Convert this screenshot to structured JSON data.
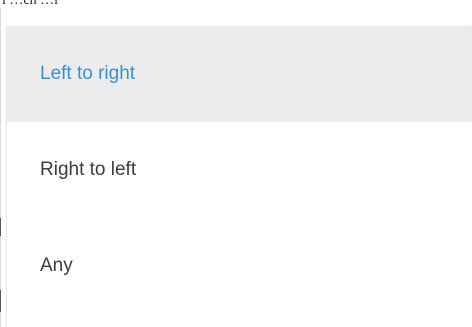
{
  "background": {
    "partial_text": "l …ch …l"
  },
  "menu": {
    "items": [
      {
        "label": "Left to right",
        "selected": true
      },
      {
        "label": "Right to left",
        "selected": false
      },
      {
        "label": "Any",
        "selected": false
      }
    ]
  },
  "colors": {
    "selected_text": "#3b8fd9",
    "selected_background": "#ececec",
    "item_text": "#3c3c3c",
    "menu_background": "#ffffff"
  }
}
